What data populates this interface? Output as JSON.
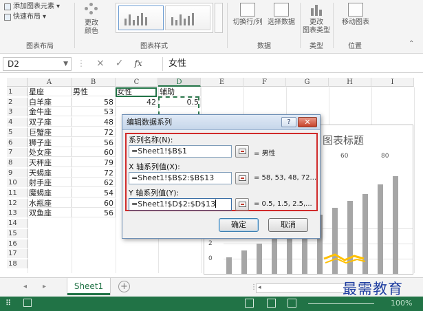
{
  "ribbon": {
    "add_element": "添加图表元素",
    "quick_layout": "快速布局",
    "change_color": "更改\n颜色",
    "switch_row_col": "切换行/列",
    "select_data": "选择数据",
    "change_type": "更改\n图表类型",
    "move_chart": "移动图表",
    "groups": {
      "layout": "图表布局",
      "styles": "图表样式",
      "data": "数据",
      "type": "类型",
      "location": "位置"
    }
  },
  "formula_bar": {
    "name_box": "D2",
    "cancel": "×",
    "confirm": "✓",
    "fx": "fx",
    "value": "女性"
  },
  "sheet": {
    "columns": [
      "A",
      "B",
      "C",
      "D",
      "E",
      "F",
      "G",
      "H",
      "I"
    ],
    "rows": [
      "1",
      "2",
      "3",
      "4",
      "5",
      "6",
      "7",
      "8",
      "9",
      "10",
      "11",
      "12",
      "13",
      "14",
      "15",
      "16",
      "17",
      "18"
    ],
    "header": [
      "星座",
      "男性",
      "女性",
      "辅助"
    ],
    "data": [
      [
        "白羊座",
        "58",
        "42",
        "0.5"
      ],
      [
        "金牛座",
        "53",
        "",
        ""
      ],
      [
        "双子座",
        "48",
        "",
        ""
      ],
      [
        "巨蟹座",
        "72",
        "",
        ""
      ],
      [
        "狮子座",
        "56",
        "",
        ""
      ],
      [
        "处女座",
        "60",
        "",
        ""
      ],
      [
        "天秤座",
        "79",
        "",
        ""
      ],
      [
        "天蝎座",
        "72",
        "",
        ""
      ],
      [
        "射手座",
        "62",
        "",
        ""
      ],
      [
        "魔蝎座",
        "54",
        "",
        ""
      ],
      [
        "水瓶座",
        "60",
        "",
        ""
      ],
      [
        "双鱼座",
        "56",
        "",
        ""
      ]
    ]
  },
  "chart": {
    "title": "图表标题",
    "top_ticks": [
      "60",
      "80"
    ],
    "left_ticks": [
      "4",
      "2",
      "0"
    ]
  },
  "dialog": {
    "title": "编辑数据系列",
    "help": "?",
    "close": "✕",
    "series_name_label": "系列名称(N):",
    "series_name_value": "=Sheet1!$B$1",
    "series_name_preview": "= 男性",
    "x_values_label": "X 轴系列值(X):",
    "x_values_value": "=Sheet1!$B$2:$B$13",
    "x_values_preview": "= 58, 53, 48, 72...",
    "y_values_label": "Y 轴系列值(Y):",
    "y_values_value": "=Sheet1!$D$2:$D$13",
    "y_values_preview": "= 0.5, 1.5, 2.5,...",
    "ok": "确定",
    "cancel": "取消"
  },
  "footer": {
    "sheet_tab": "Sheet1",
    "add_sheet": "+",
    "nav_prev": "◂",
    "nav_next": "▸",
    "zoom": "100%",
    "watermark": "最需教育"
  },
  "colors": {
    "excel_green": "#217346",
    "highlight_red": "#d02a2a",
    "bar_gray": "#a6a6a6",
    "series_orange": "#ffc000"
  }
}
